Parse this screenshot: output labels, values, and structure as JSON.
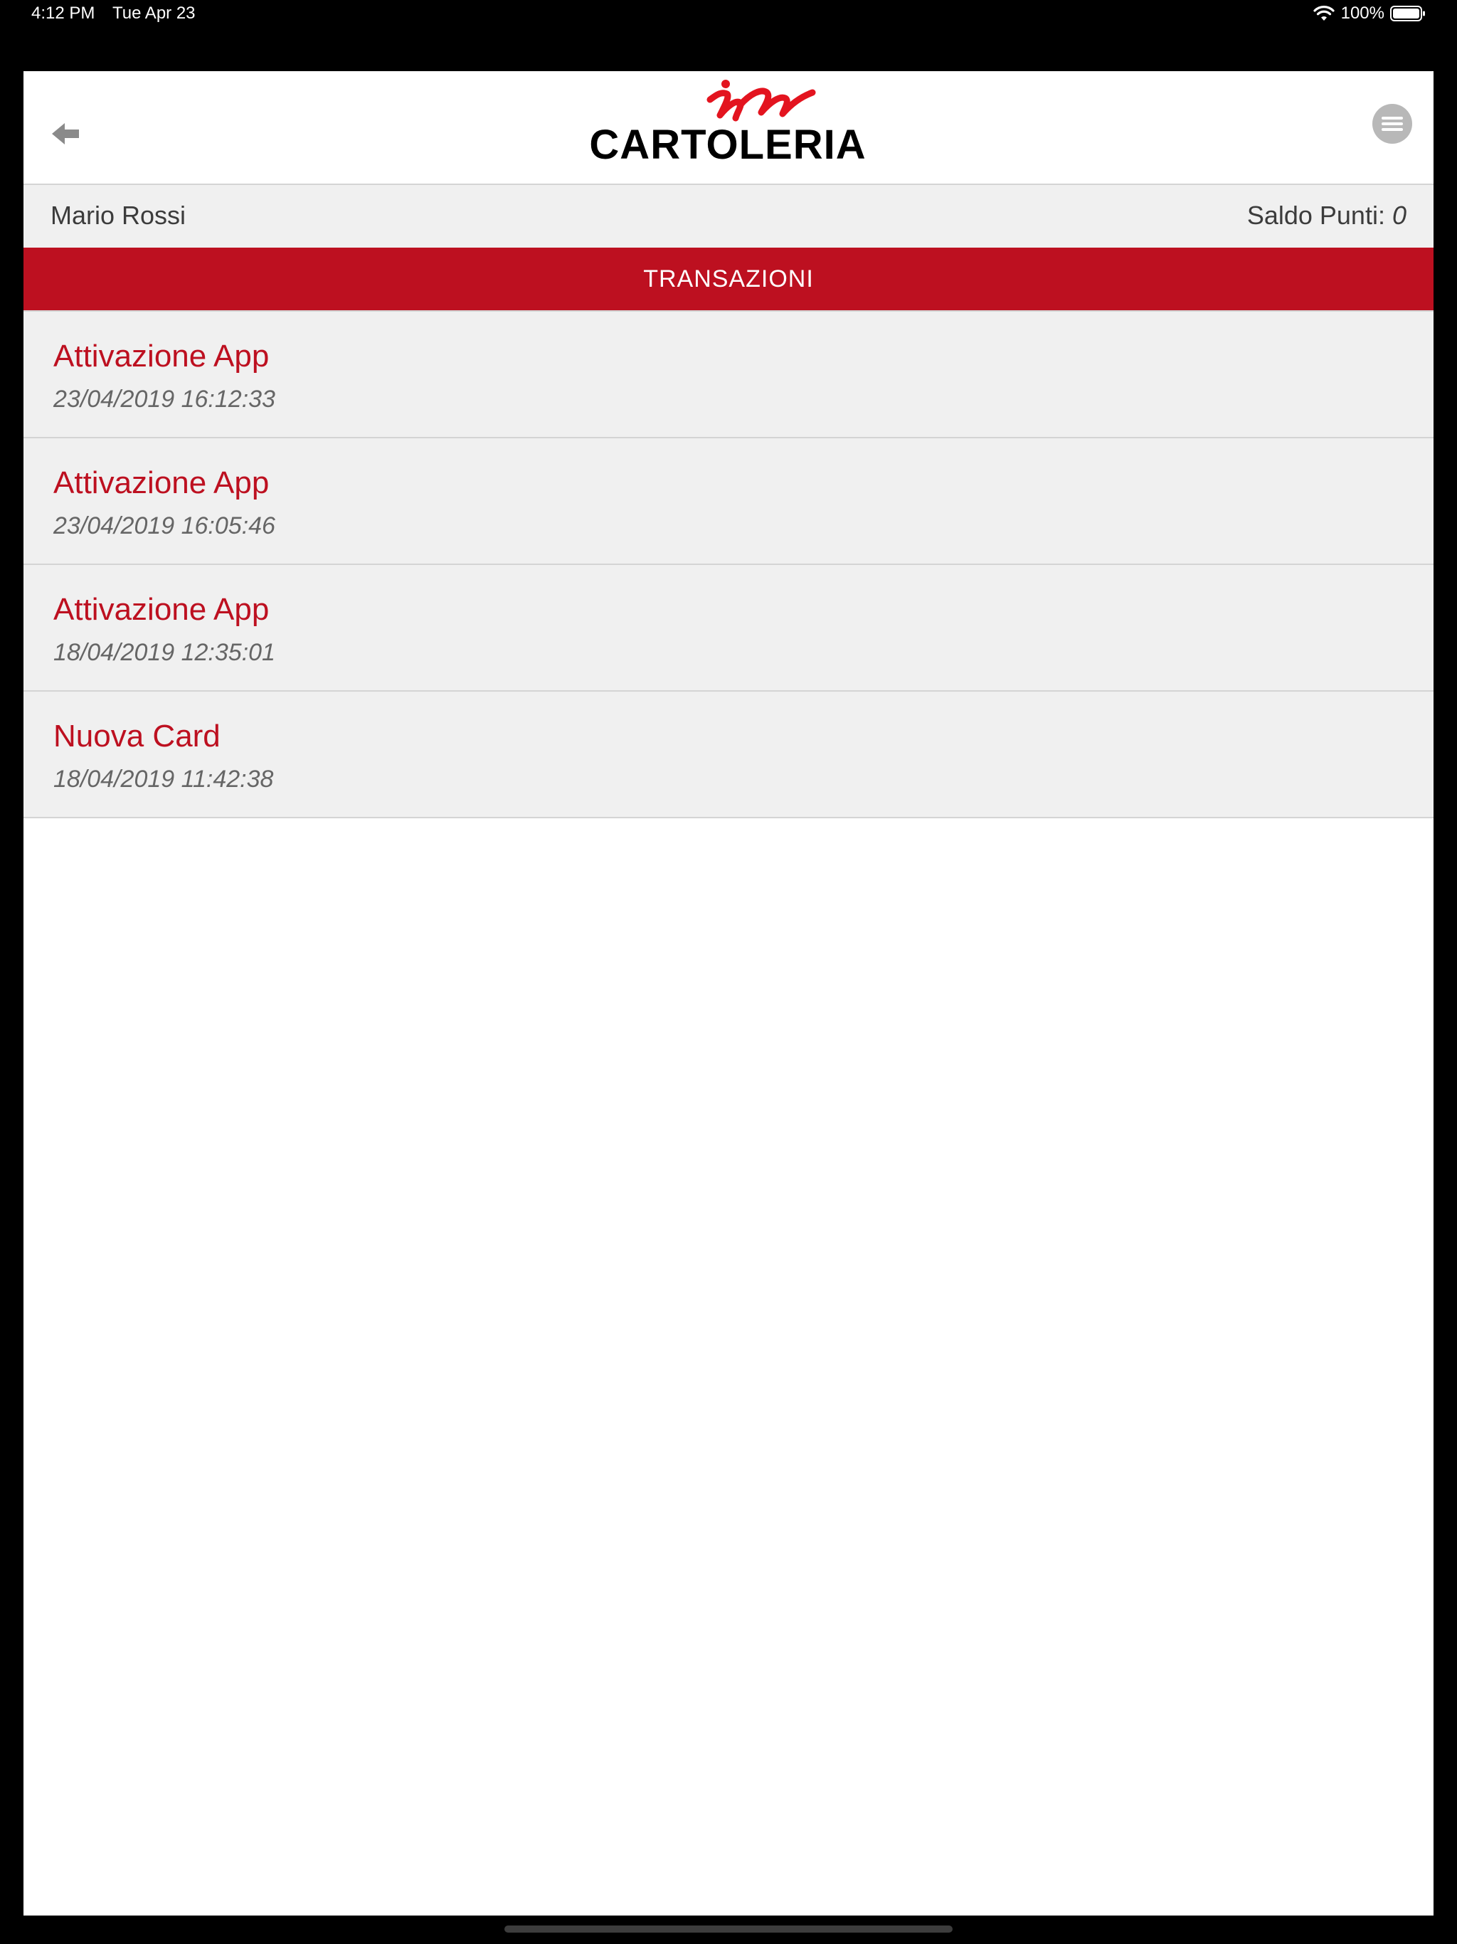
{
  "status_bar": {
    "time": "4:12 PM",
    "date": "Tue Apr 23",
    "battery": "100%",
    "icons": [
      "wifi-icon",
      "battery-icon"
    ]
  },
  "header": {
    "logo_script": "in",
    "logo_text": "CARTOLERIA",
    "back_icon": "back-arrow-icon",
    "menu_icon": "hamburger-menu-icon"
  },
  "user": {
    "name": "Mario Rossi",
    "points_label": "Saldo Punti:",
    "points_value": "0"
  },
  "section": {
    "title": "TRANSAZIONI"
  },
  "transactions": [
    {
      "title": "Attivazione App",
      "date": "23/04/2019 16:12:33"
    },
    {
      "title": "Attivazione App",
      "date": "23/04/2019 16:05:46"
    },
    {
      "title": "Attivazione App",
      "date": "18/04/2019 12:35:01"
    },
    {
      "title": "Nuova Card",
      "date": "18/04/2019 11:42:38"
    }
  ],
  "colors": {
    "brand_red": "#bd1020",
    "logo_red": "#e3141f",
    "list_background": "#f0f0f0",
    "divider": "#d4d4d4"
  }
}
